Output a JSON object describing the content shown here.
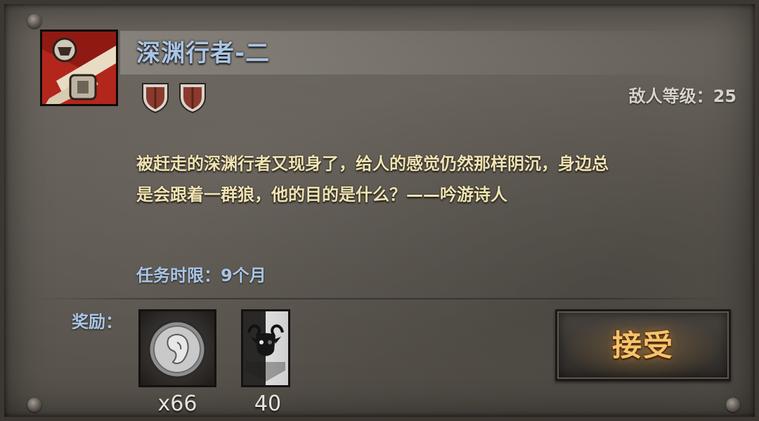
{
  "quest": {
    "title": "深渊行者-二",
    "enemy_level": "敌人等级：25",
    "description_line1": "被赶走的深渊行者又现身了，给人的感觉仍然那样阴沉，身边总",
    "description_line2": "是会跟着一群狼，他的目的是什么？——吟游诗人",
    "time_limit": "任务时限：9个月",
    "difficulty_shields": 2
  },
  "rewards": {
    "label": "奖励：",
    "items": [
      {
        "icon": "silver-coin-icon",
        "count": "x66"
      },
      {
        "icon": "bull-banner-icon",
        "count": "40"
      }
    ]
  },
  "actions": {
    "accept_label": "接受"
  },
  "colors": {
    "title": "#a9c6e6",
    "description": "#f0e3b2",
    "accept": "#f6c36b",
    "panel": "#5f5a53"
  }
}
